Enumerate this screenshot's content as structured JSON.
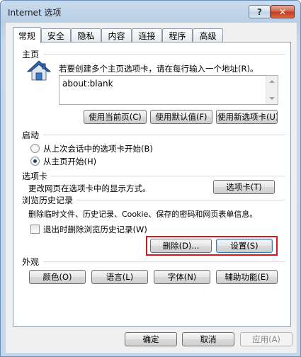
{
  "window": {
    "title": "Internet 选项",
    "help_label": "?",
    "close_label": "✕"
  },
  "tabs": [
    "常规",
    "安全",
    "隐私",
    "内容",
    "连接",
    "程序",
    "高级"
  ],
  "home": {
    "title": "主页",
    "description": "若要创建多个主页选项卡，请在每行输入一个地址(R)。",
    "value": "about:blank",
    "btn_current": "使用当前页(C)",
    "btn_default": "使用默认值(F)",
    "btn_new_tab": "使用新选项卡(U)"
  },
  "startup": {
    "title": "启动",
    "option_last_session": "从上次会话中的选项卡开始(B)",
    "option_home": "从主页开始(H)",
    "selected": "home"
  },
  "tabs_section": {
    "title": "选项卡",
    "description": "更改网页在选项卡中的显示方式。",
    "button": "选项卡(T)"
  },
  "history": {
    "title": "浏览历史记录",
    "description": "删除临时文件、历史记录、Cookie、保存的密码和网页表单信息。",
    "checkbox_label": "退出时删除浏览历史记录(W)",
    "checkbox_checked": false,
    "btn_delete": "删除(D)...",
    "btn_settings": "设置(S)"
  },
  "appearance": {
    "title": "外观",
    "btn_colors": "颜色(O)",
    "btn_languages": "语言(L)",
    "btn_fonts": "字体(N)",
    "btn_accessibility": "辅助功能(E)"
  },
  "footer": {
    "ok": "确定",
    "cancel": "取消",
    "apply": "应用(A)"
  },
  "colors": {
    "highlight": "#d4171e"
  }
}
